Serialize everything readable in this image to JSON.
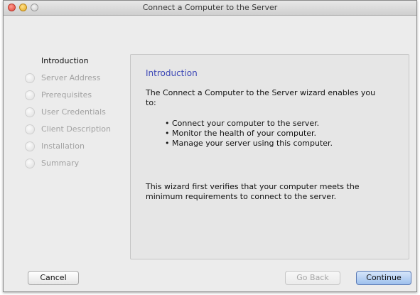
{
  "window": {
    "title": "Connect a Computer to the Server"
  },
  "steps": [
    {
      "label": "Introduction",
      "current": true
    },
    {
      "label": "Server Address",
      "current": false
    },
    {
      "label": "Prerequisites",
      "current": false
    },
    {
      "label": "User Credentials",
      "current": false
    },
    {
      "label": "Client Description",
      "current": false
    },
    {
      "label": "Installation",
      "current": false
    },
    {
      "label": "Summary",
      "current": false
    }
  ],
  "panel": {
    "heading": "Introduction",
    "intro": "The Connect a Computer to the Server wizard enables you to:",
    "bullets": [
      "Connect your computer to the server.",
      "Monitor the health of your computer.",
      "Manage your server using this computer."
    ],
    "note": "This wizard first verifies that your computer meets the minimum requirements to connect to the server."
  },
  "buttons": {
    "cancel": "Cancel",
    "back": "Go Back",
    "continue": "Continue"
  },
  "colors": {
    "heading": "#3c47b6",
    "default_button": "#9ec0ed",
    "close": "#e0443a",
    "minimize": "#e5a91f"
  }
}
